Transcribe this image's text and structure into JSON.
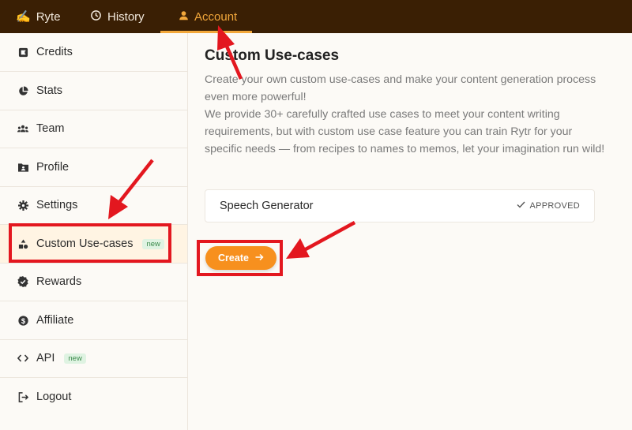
{
  "nav": {
    "brand": "Ryte",
    "history": "History",
    "account": "Account"
  },
  "sidebar": {
    "items": [
      {
        "label": "Credits",
        "icon": "credits-icon"
      },
      {
        "label": "Stats",
        "icon": "pie-chart-icon"
      },
      {
        "label": "Team",
        "icon": "team-icon"
      },
      {
        "label": "Profile",
        "icon": "profile-icon"
      },
      {
        "label": "Settings",
        "icon": "gear-icon"
      },
      {
        "label": "Custom Use-cases",
        "icon": "shapes-icon",
        "badge": "new"
      },
      {
        "label": "Rewards",
        "icon": "rewards-icon"
      },
      {
        "label": "Affiliate",
        "icon": "dollar-icon"
      },
      {
        "label": "API",
        "icon": "code-icon",
        "badge": "new"
      },
      {
        "label": "Logout",
        "icon": "logout-icon"
      }
    ]
  },
  "main": {
    "title": "Custom Use-cases",
    "subtitle": "Create your own custom use-cases and make your content generation process even more powerful!",
    "description": "We provide 30+ carefully crafted use cases to meet your content writing requirements, but with custom use case feature you can train Rytr for your specific needs — from recipes to names to memos, let your imagination run wild!",
    "usecase": {
      "name": "Speech Generator",
      "status": "APPROVED"
    },
    "create_label": "Create"
  },
  "colors": {
    "topbar": "#3a1f04",
    "accent": "#f3a83b",
    "button": "#f7901e",
    "annotation": "#e3171f"
  }
}
